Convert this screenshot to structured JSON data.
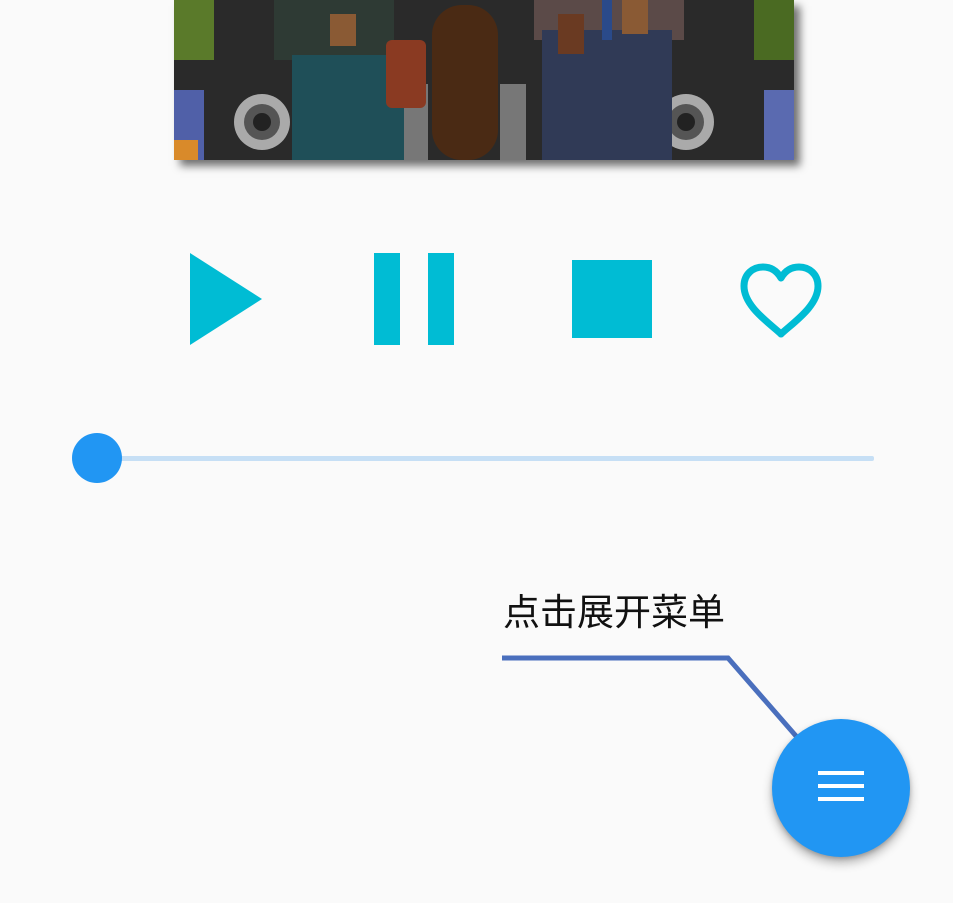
{
  "player": {
    "album_art": "album-cover-illustration",
    "controls": [
      {
        "name": "play",
        "icon": "play-icon"
      },
      {
        "name": "pause",
        "icon": "pause-icon"
      },
      {
        "name": "stop",
        "icon": "stop-icon"
      },
      {
        "name": "favorite",
        "icon": "heart-outline-icon"
      }
    ],
    "accent_color": "#00bcd4",
    "progress": 0
  },
  "slider": {
    "thumb_color": "#2196f3",
    "track_color": "#c6dff5"
  },
  "hint": {
    "text": "点击展开菜单",
    "line_color": "#4a6fbd"
  },
  "fab": {
    "icon": "menu-icon",
    "color": "#2196f3"
  }
}
